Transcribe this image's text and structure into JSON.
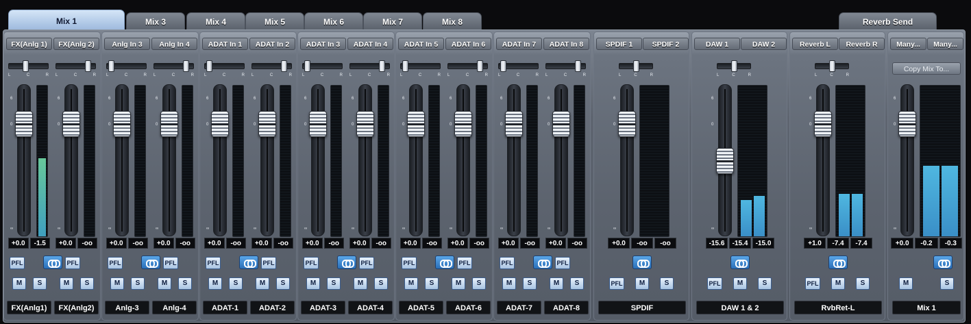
{
  "tabs": [
    {
      "label": "Mix 1",
      "active": true
    },
    {
      "label": "Mix 3"
    },
    {
      "label": "Mix 4"
    },
    {
      "label": "Mix 5"
    },
    {
      "label": "Mix 6"
    },
    {
      "label": "Mix 7"
    },
    {
      "label": "Mix 8"
    },
    {
      "label": "Reverb Send"
    }
  ],
  "fader_scale": {
    "top": "6",
    "unity": "0",
    "bottom": "∞"
  },
  "pan_scale": {
    "left": "L",
    "center": "C",
    "right": "R"
  },
  "buttons": {
    "pfl": "PFL",
    "mute": "M",
    "solo": "S"
  },
  "copy_mix_label": "Copy Mix To...",
  "colors": {
    "accent": "#4ea3e0",
    "meter": "#3a8fc7",
    "tab_active": "#b5cde9"
  },
  "channels": [
    {
      "inputs": [
        "FX(Anlg 1)",
        "FX(Anlg 2)"
      ],
      "layout": "pair",
      "pairs": [
        {
          "name": "FX(Anlg1)",
          "fader_db": "+0.0",
          "meter_db": "-1.5",
          "meter_level": 0.52,
          "meter_color": "green",
          "pan": 0.42
        },
        {
          "name": "FX(Anlg2)",
          "fader_db": "+0.0",
          "meter_db": "-oo",
          "meter_level": 0,
          "pan": 0.85
        }
      ]
    },
    {
      "inputs": [
        "Anlg In 3",
        "Anlg In 4"
      ],
      "layout": "pair",
      "pairs": [
        {
          "name": "Anlg-3",
          "fader_db": "+0.0",
          "meter_db": "-oo",
          "meter_level": 0,
          "pan": 0.05
        },
        {
          "name": "Anlg-4",
          "fader_db": "+0.0",
          "meter_db": "-oo",
          "meter_level": 0,
          "pan": 0.85
        }
      ]
    },
    {
      "inputs": [
        "ADAT In 1",
        "ADAT In 2"
      ],
      "layout": "pair",
      "pairs": [
        {
          "name": "ADAT-1",
          "fader_db": "+0.0",
          "meter_db": "-oo",
          "meter_level": 0,
          "pan": 0.05
        },
        {
          "name": "ADAT-2",
          "fader_db": "+0.0",
          "meter_db": "-oo",
          "meter_level": 0,
          "pan": 0.85
        }
      ]
    },
    {
      "inputs": [
        "ADAT In 3",
        "ADAT In 4"
      ],
      "layout": "pair",
      "pairs": [
        {
          "name": "ADAT-3",
          "fader_db": "+0.0",
          "meter_db": "-oo",
          "meter_level": 0,
          "pan": 0.05
        },
        {
          "name": "ADAT-4",
          "fader_db": "+0.0",
          "meter_db": "-oo",
          "meter_level": 0,
          "pan": 0.85
        }
      ]
    },
    {
      "inputs": [
        "ADAT In 5",
        "ADAT In 6"
      ],
      "layout": "pair",
      "pairs": [
        {
          "name": "ADAT-5",
          "fader_db": "+0.0",
          "meter_db": "-oo",
          "meter_level": 0,
          "pan": 0.05
        },
        {
          "name": "ADAT-6",
          "fader_db": "+0.0",
          "meter_db": "-oo",
          "meter_level": 0,
          "pan": 0.85
        }
      ]
    },
    {
      "inputs": [
        "ADAT In 7",
        "ADAT In 8"
      ],
      "layout": "pair",
      "pairs": [
        {
          "name": "ADAT-7",
          "fader_db": "+0.0",
          "meter_db": "-oo",
          "meter_level": 0,
          "pan": 0.05
        },
        {
          "name": "ADAT-8",
          "fader_db": "+0.0",
          "meter_db": "-oo",
          "meter_level": 0,
          "pan": 0.85
        }
      ]
    },
    {
      "inputs": [
        "SPDIF 1",
        "SPDIF 2"
      ],
      "layout": "stereo",
      "name": "SPDIF",
      "fader_db": "+0.0",
      "meter_db": [
        "-oo",
        "-oo"
      ],
      "meter_levels": [
        0,
        0
      ],
      "pan": 0.5
    },
    {
      "inputs": [
        "DAW 1",
        "DAW 2"
      ],
      "layout": "stereo",
      "name": "DAW 1 & 2",
      "fader_db": "-15.6",
      "fader_level": 0.6,
      "meter_db": [
        "-15.4",
        "-15.0"
      ],
      "meter_levels": [
        0.24,
        0.27
      ],
      "pan": 0.5
    },
    {
      "inputs": [
        "Reverb L",
        "Reverb R"
      ],
      "layout": "stereo",
      "name": "RvbRet-L",
      "fader_db": "+1.0",
      "meter_db": [
        "-7.4",
        "-7.4"
      ],
      "meter_levels": [
        0.28,
        0.28
      ],
      "pan": 0.5
    },
    {
      "inputs": [
        "Many...",
        "Many..."
      ],
      "layout": "master",
      "name": "Mix 1",
      "fader_db": "+0.0",
      "meter_db": [
        "-0.2",
        "-0.3"
      ],
      "meter_levels": [
        0.47,
        0.47
      ]
    }
  ]
}
